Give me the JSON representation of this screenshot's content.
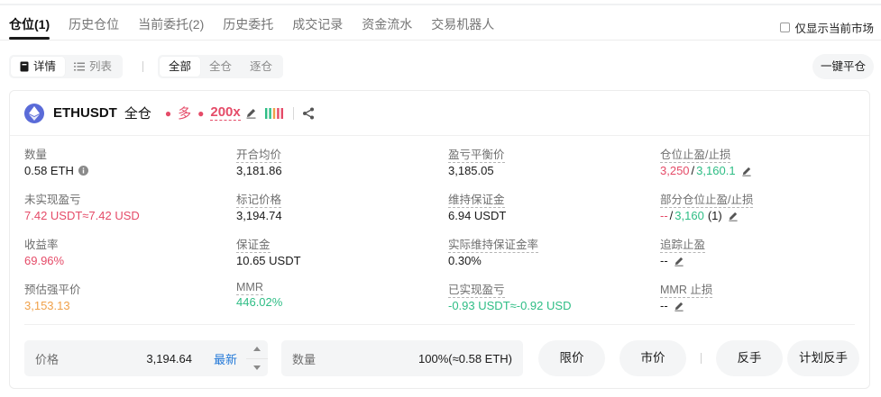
{
  "tabs": [
    {
      "label": "仓位(1)",
      "active": true
    },
    {
      "label": "历史仓位"
    },
    {
      "label": "当前委托(2)"
    },
    {
      "label": "历史委托"
    },
    {
      "label": "成交记录"
    },
    {
      "label": "资金流水"
    },
    {
      "label": "交易机器人"
    }
  ],
  "filter": {
    "only_current_market": "仅显示当前市场",
    "checked": false
  },
  "view_toggle": {
    "detail": "详情",
    "list": "列表",
    "active": "detail"
  },
  "margin_filter": {
    "all": "全部",
    "cross": "全仓",
    "isolated": "逐仓",
    "active": "all"
  },
  "close_all_button": "一键平仓",
  "position": {
    "coin_icon": "ethereum-icon",
    "symbol": "ETHUSDT",
    "margin_mode": "全仓",
    "side": "多",
    "leverage": "200x",
    "colors": {
      "up": "#2ebd85",
      "down": "#e54b68",
      "warn": "#f0a14a",
      "link": "#2479d8"
    },
    "fields": {
      "quantity": {
        "label": "数量",
        "value": "0.58 ETH"
      },
      "entry_price": {
        "label": "开合均价",
        "value": "3,181.86"
      },
      "break_even": {
        "label": "盈亏平衡价",
        "value": "3,185.05"
      },
      "tpsl": {
        "label": "仓位止盈/止损",
        "tp": "3,250",
        "sep": "/",
        "sl": "3,160.1"
      },
      "unrealized_pnl": {
        "label": "未实现盈亏",
        "value": "7.42 USDT≈7.42 USD"
      },
      "mark_price": {
        "label": "标记价格",
        "value": "3,194.74"
      },
      "maint_margin": {
        "label": "维持保证金",
        "value": "6.94 USDT"
      },
      "partial_tpsl": {
        "label": "部分仓位止盈/止损",
        "tp": "--",
        "sep": "/",
        "sl": "3,160",
        "count": "(1)"
      },
      "roe": {
        "label": "收益率",
        "value": "69.96%"
      },
      "margin": {
        "label": "保证金",
        "value": "10.65 USDT"
      },
      "actual_maint_rate": {
        "label": "实际维持保证金率",
        "value": "0.30%"
      },
      "trailing_stop": {
        "label": "追踪止盈",
        "value": "--"
      },
      "liq_price": {
        "label": "预估强平价",
        "value": "3,153.13"
      },
      "mmr": {
        "label": "MMR",
        "value": "446.02%"
      },
      "realized_pnl": {
        "label": "已实现盈亏",
        "value": "-0.93 USDT≈-0.92 USD"
      },
      "mmr_sl": {
        "label": "MMR 止损",
        "value": "--"
      }
    }
  },
  "order_bar": {
    "price_label": "价格",
    "price_value": "3,194.64",
    "latest": "最新",
    "qty_label": "数量",
    "qty_value": "100%(≈0.58 ETH)",
    "limit_button": "限价",
    "market_button": "市价",
    "reverse_button": "反手",
    "plan_reverse_button": "计划反手"
  }
}
